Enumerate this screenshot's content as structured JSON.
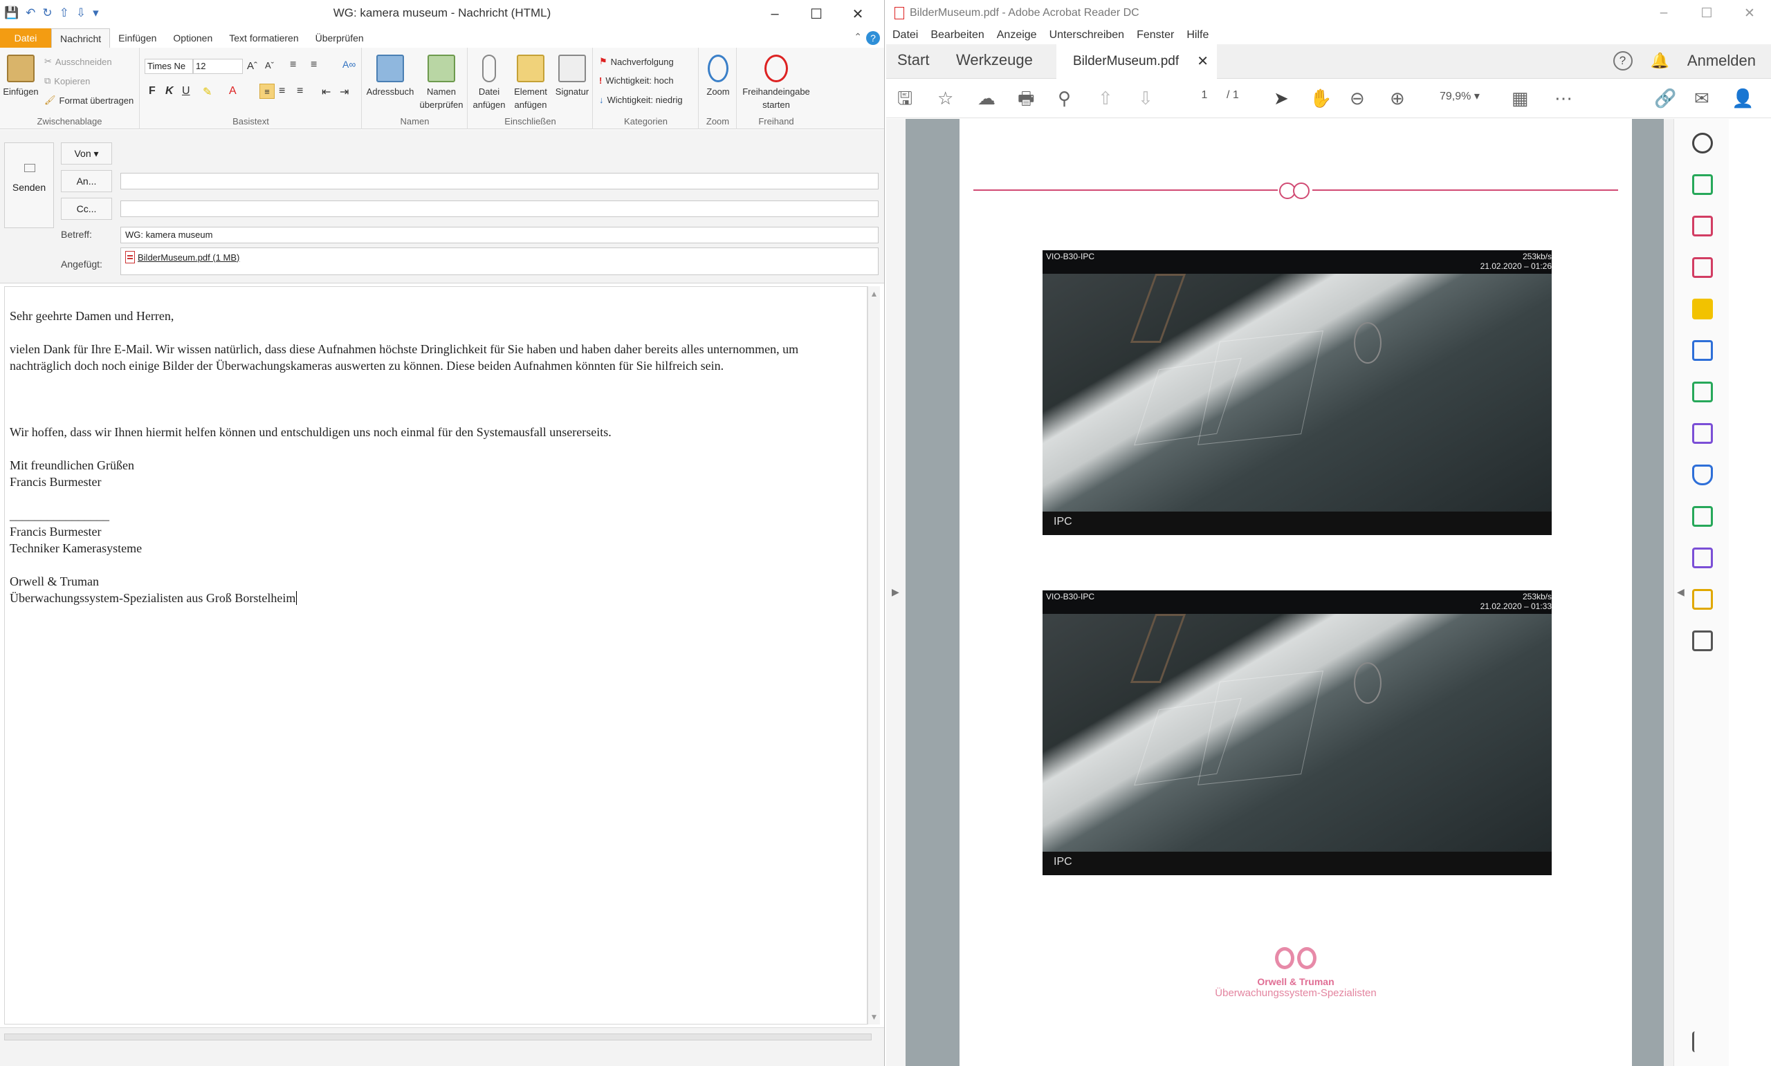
{
  "outlook": {
    "window_title": "WG: kamera museum  -  Nachricht (HTML)",
    "tabs": [
      "Datei",
      "Nachricht",
      "Einfügen",
      "Optionen",
      "Text formatieren",
      "Überprüfen"
    ],
    "ribbon": {
      "clipboard": {
        "paste": "Einfügen",
        "cut": "Ausschneiden",
        "copy": "Kopieren",
        "format_painter": "Format übertragen",
        "group": "Zwischenablage"
      },
      "basic_text": {
        "font": "Times Ne",
        "size": "12",
        "group": "Basistext"
      },
      "names": {
        "address_book": "Adressbuch",
        "check_names_1": "Namen",
        "check_names_2": "überprüfen",
        "group": "Namen"
      },
      "include": {
        "attach_file_1": "Datei",
        "attach_file_2": "anfügen",
        "attach_item_1": "Element",
        "attach_item_2": "anfügen",
        "signature": "Signatur",
        "group": "Einschließen"
      },
      "tags": {
        "followup": "Nachverfolgung",
        "high": "Wichtigkeit: hoch",
        "low": "Wichtigkeit: niedrig",
        "group": "Kategorien"
      },
      "zoom": {
        "label": "Zoom",
        "group": "Zoom"
      },
      "freehand": {
        "label1": "Freihandeingabe",
        "label2": "starten",
        "group": "Freihand"
      }
    },
    "header": {
      "send": "Senden",
      "from": "Von",
      "to": "An...",
      "cc": "Cc...",
      "subject_label": "Betreff:",
      "subject": "WG: kamera museum",
      "attached_label": "Angefügt:",
      "attachment": "BilderMuseum.pdf (1 MB)"
    },
    "body": {
      "greeting": "Sehr geehrte Damen und Herren,",
      "para1": "vielen Dank für Ihre E-Mail. Wir wissen natürlich, dass diese Aufnahmen höchste Dringlichkeit für Sie haben und haben daher bereits alles unternommen, um nachträglich doch noch einige Bilder der Überwachungskameras auswerten zu können. Diese beiden Aufnahmen könnten für Sie hilfreich sein.",
      "para2": "Wir hoffen, dass wir Ihnen hiermit helfen können und entschuldigen uns noch einmal für den Systemausfall unsererseits.",
      "closing1": "Mit freundlichen Grüßen",
      "closing2": "Francis Burmester",
      "sig_line": "________________",
      "sig_name": "Francis Burmester",
      "sig_role": "Techniker Kamerasysteme",
      "sig_company": "Orwell & Truman",
      "sig_tagline": "Überwachungssystem-Spezialisten aus Groß Borstelheim"
    }
  },
  "acrobat": {
    "window_title": "BilderMuseum.pdf - Adobe Acrobat Reader DC",
    "menu": [
      "Datei",
      "Bearbeiten",
      "Anzeige",
      "Unterschreiben",
      "Fenster",
      "Hilfe"
    ],
    "tabs": {
      "home": "Start",
      "tools": "Werkzeuge",
      "doc": "BilderMuseum.pdf",
      "signin": "Anmelden"
    },
    "toolbar": {
      "page_current": "1",
      "page_total": "/ 1",
      "zoom": "79,9%"
    },
    "doc": {
      "cam1": {
        "id": "VIO-B30-IPC",
        "rate": "253kb/s",
        "time": "21.02.2020 – 01:26",
        "label": "IPC"
      },
      "cam2": {
        "id": "VIO-B30-IPC",
        "rate": "253kb/s",
        "time": "21.02.2020 – 01:33",
        "label": "IPC"
      },
      "logo_name": "Orwell & Truman",
      "logo_tagline": "Überwachungssystem-Spezialisten"
    }
  }
}
